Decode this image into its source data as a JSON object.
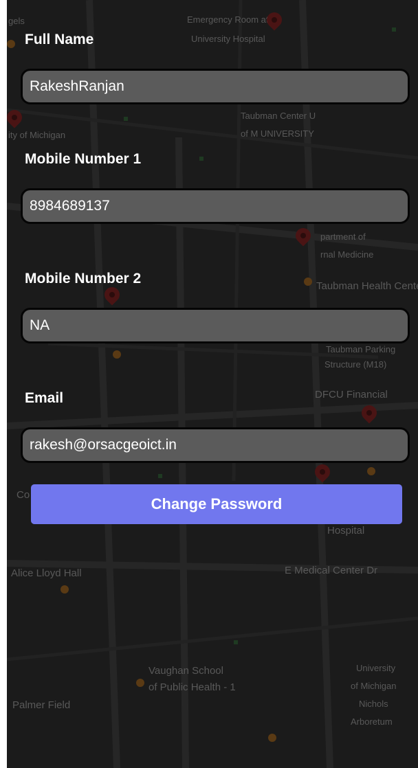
{
  "map": {
    "labels": [
      "gels",
      "Emergency Room at",
      "University Hospital",
      "Taubman Center U",
      "of M UNIVERSITY",
      "ity of Michigan",
      "partment of",
      "rnal Medicine",
      "Taubman Health Center",
      "Taubman Parking",
      "Structure (M18)",
      "DFCU Financial",
      "E Medical Center Dr",
      "Alice Lloyd Hall",
      "Vaughan School",
      "of Public Health - 1",
      "University",
      "of Michigan",
      "Nichols",
      "Arboretum",
      "Palmer Field",
      "Co",
      "Hospital"
    ]
  },
  "form": {
    "full_name": {
      "label": "Full Name",
      "value": "RakeshRanjan"
    },
    "mobile1": {
      "label": "Mobile Number 1",
      "value": "8984689137"
    },
    "mobile2": {
      "label": "Mobile Number 2",
      "value": "NA"
    },
    "email": {
      "label": "Email",
      "value": "rakesh@orsacgeoict.in"
    }
  },
  "actions": {
    "change_password": "Change Password"
  },
  "colors": {
    "button": "#7177ee",
    "input_bg": "#5b5b5b",
    "overlay": "#1b1b1b"
  }
}
